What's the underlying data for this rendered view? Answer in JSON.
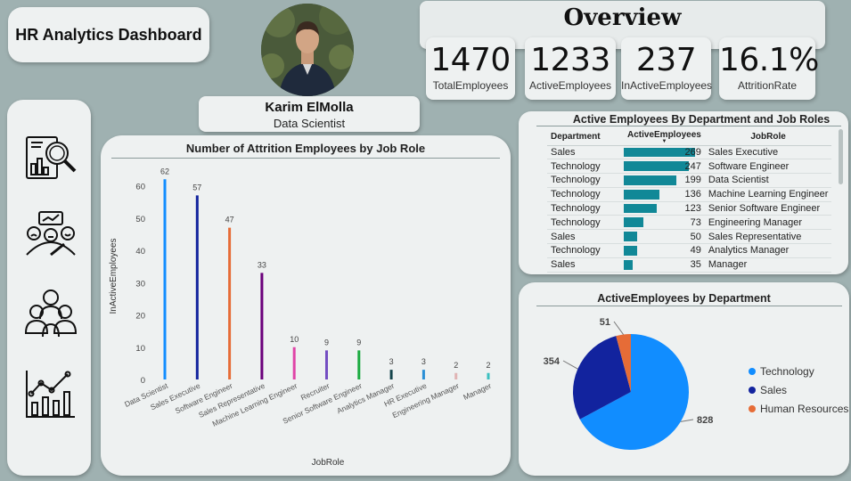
{
  "header": {
    "title": "HR Analytics Dashboard"
  },
  "profile": {
    "name": "Karim ElMolla",
    "role": "Data Scientist"
  },
  "overview": {
    "title": "Overview",
    "kpis": [
      {
        "value": "1470",
        "label": "TotalEmployees"
      },
      {
        "value": "1233",
        "label": "ActiveEmployees"
      },
      {
        "value": "237",
        "label": "InActiveEmployees"
      },
      {
        "value": "16.1%",
        "label": "AttritionRate"
      }
    ]
  },
  "sidebar": {
    "icons": [
      "analytics-search-icon",
      "employee-mood-icon",
      "team-icon",
      "growth-chart-icon"
    ]
  },
  "chart_data": [
    {
      "type": "bar",
      "title": "Number of Attrition Employees by Job Role",
      "xlabel": "JobRole",
      "ylabel": "InActiveEmployees",
      "ylim": [
        0,
        65
      ],
      "yticks": [
        0,
        10,
        20,
        30,
        40,
        50,
        60
      ],
      "categories": [
        "Data Scientist",
        "Sales Executive",
        "Software Engineer",
        "Sales Representative",
        "Machine Learning Engineer",
        "Recruiter",
        "Senior Software Engineer",
        "Analytics Manager",
        "HR Executive",
        "Engineering Manager",
        "Manager"
      ],
      "values": [
        62,
        57,
        47,
        33,
        10,
        9,
        9,
        3,
        3,
        2,
        2
      ],
      "colors": [
        "#118dff",
        "#12239e",
        "#e66c37",
        "#6b007b",
        "#e044a7",
        "#744ec2",
        "#1aab40",
        "#15454c",
        "#2b8fd6",
        "#e0b4b4",
        "#3cc0c0"
      ],
      "grid": false
    },
    {
      "type": "pie",
      "title": "ActiveEmployees by Department",
      "categories": [
        "Technology",
        "Sales",
        "Human Resources"
      ],
      "values": [
        828,
        354,
        51
      ],
      "colors": [
        "#118dff",
        "#12239e",
        "#e66c37"
      ],
      "legend": "right"
    }
  ],
  "table": {
    "title": "Active Employees By Department and Job Roles",
    "columns": [
      "Department",
      "ActiveEmployees",
      "JobRole"
    ],
    "rows": [
      {
        "department": "Sales",
        "active": 269,
        "role": "Sales Executive"
      },
      {
        "department": "Technology",
        "active": 247,
        "role": "Software Engineer"
      },
      {
        "department": "Technology",
        "active": 199,
        "role": "Data Scientist"
      },
      {
        "department": "Technology",
        "active": 136,
        "role": "Machine Learning Engineer"
      },
      {
        "department": "Technology",
        "active": 123,
        "role": "Senior Software Engineer"
      },
      {
        "department": "Technology",
        "active": 73,
        "role": "Engineering Manager"
      },
      {
        "department": "Sales",
        "active": 50,
        "role": "Sales Representative"
      },
      {
        "department": "Technology",
        "active": 49,
        "role": "Analytics Manager"
      },
      {
        "department": "Sales",
        "active": 35,
        "role": "Manager"
      }
    ],
    "bar_color": "#118897"
  }
}
